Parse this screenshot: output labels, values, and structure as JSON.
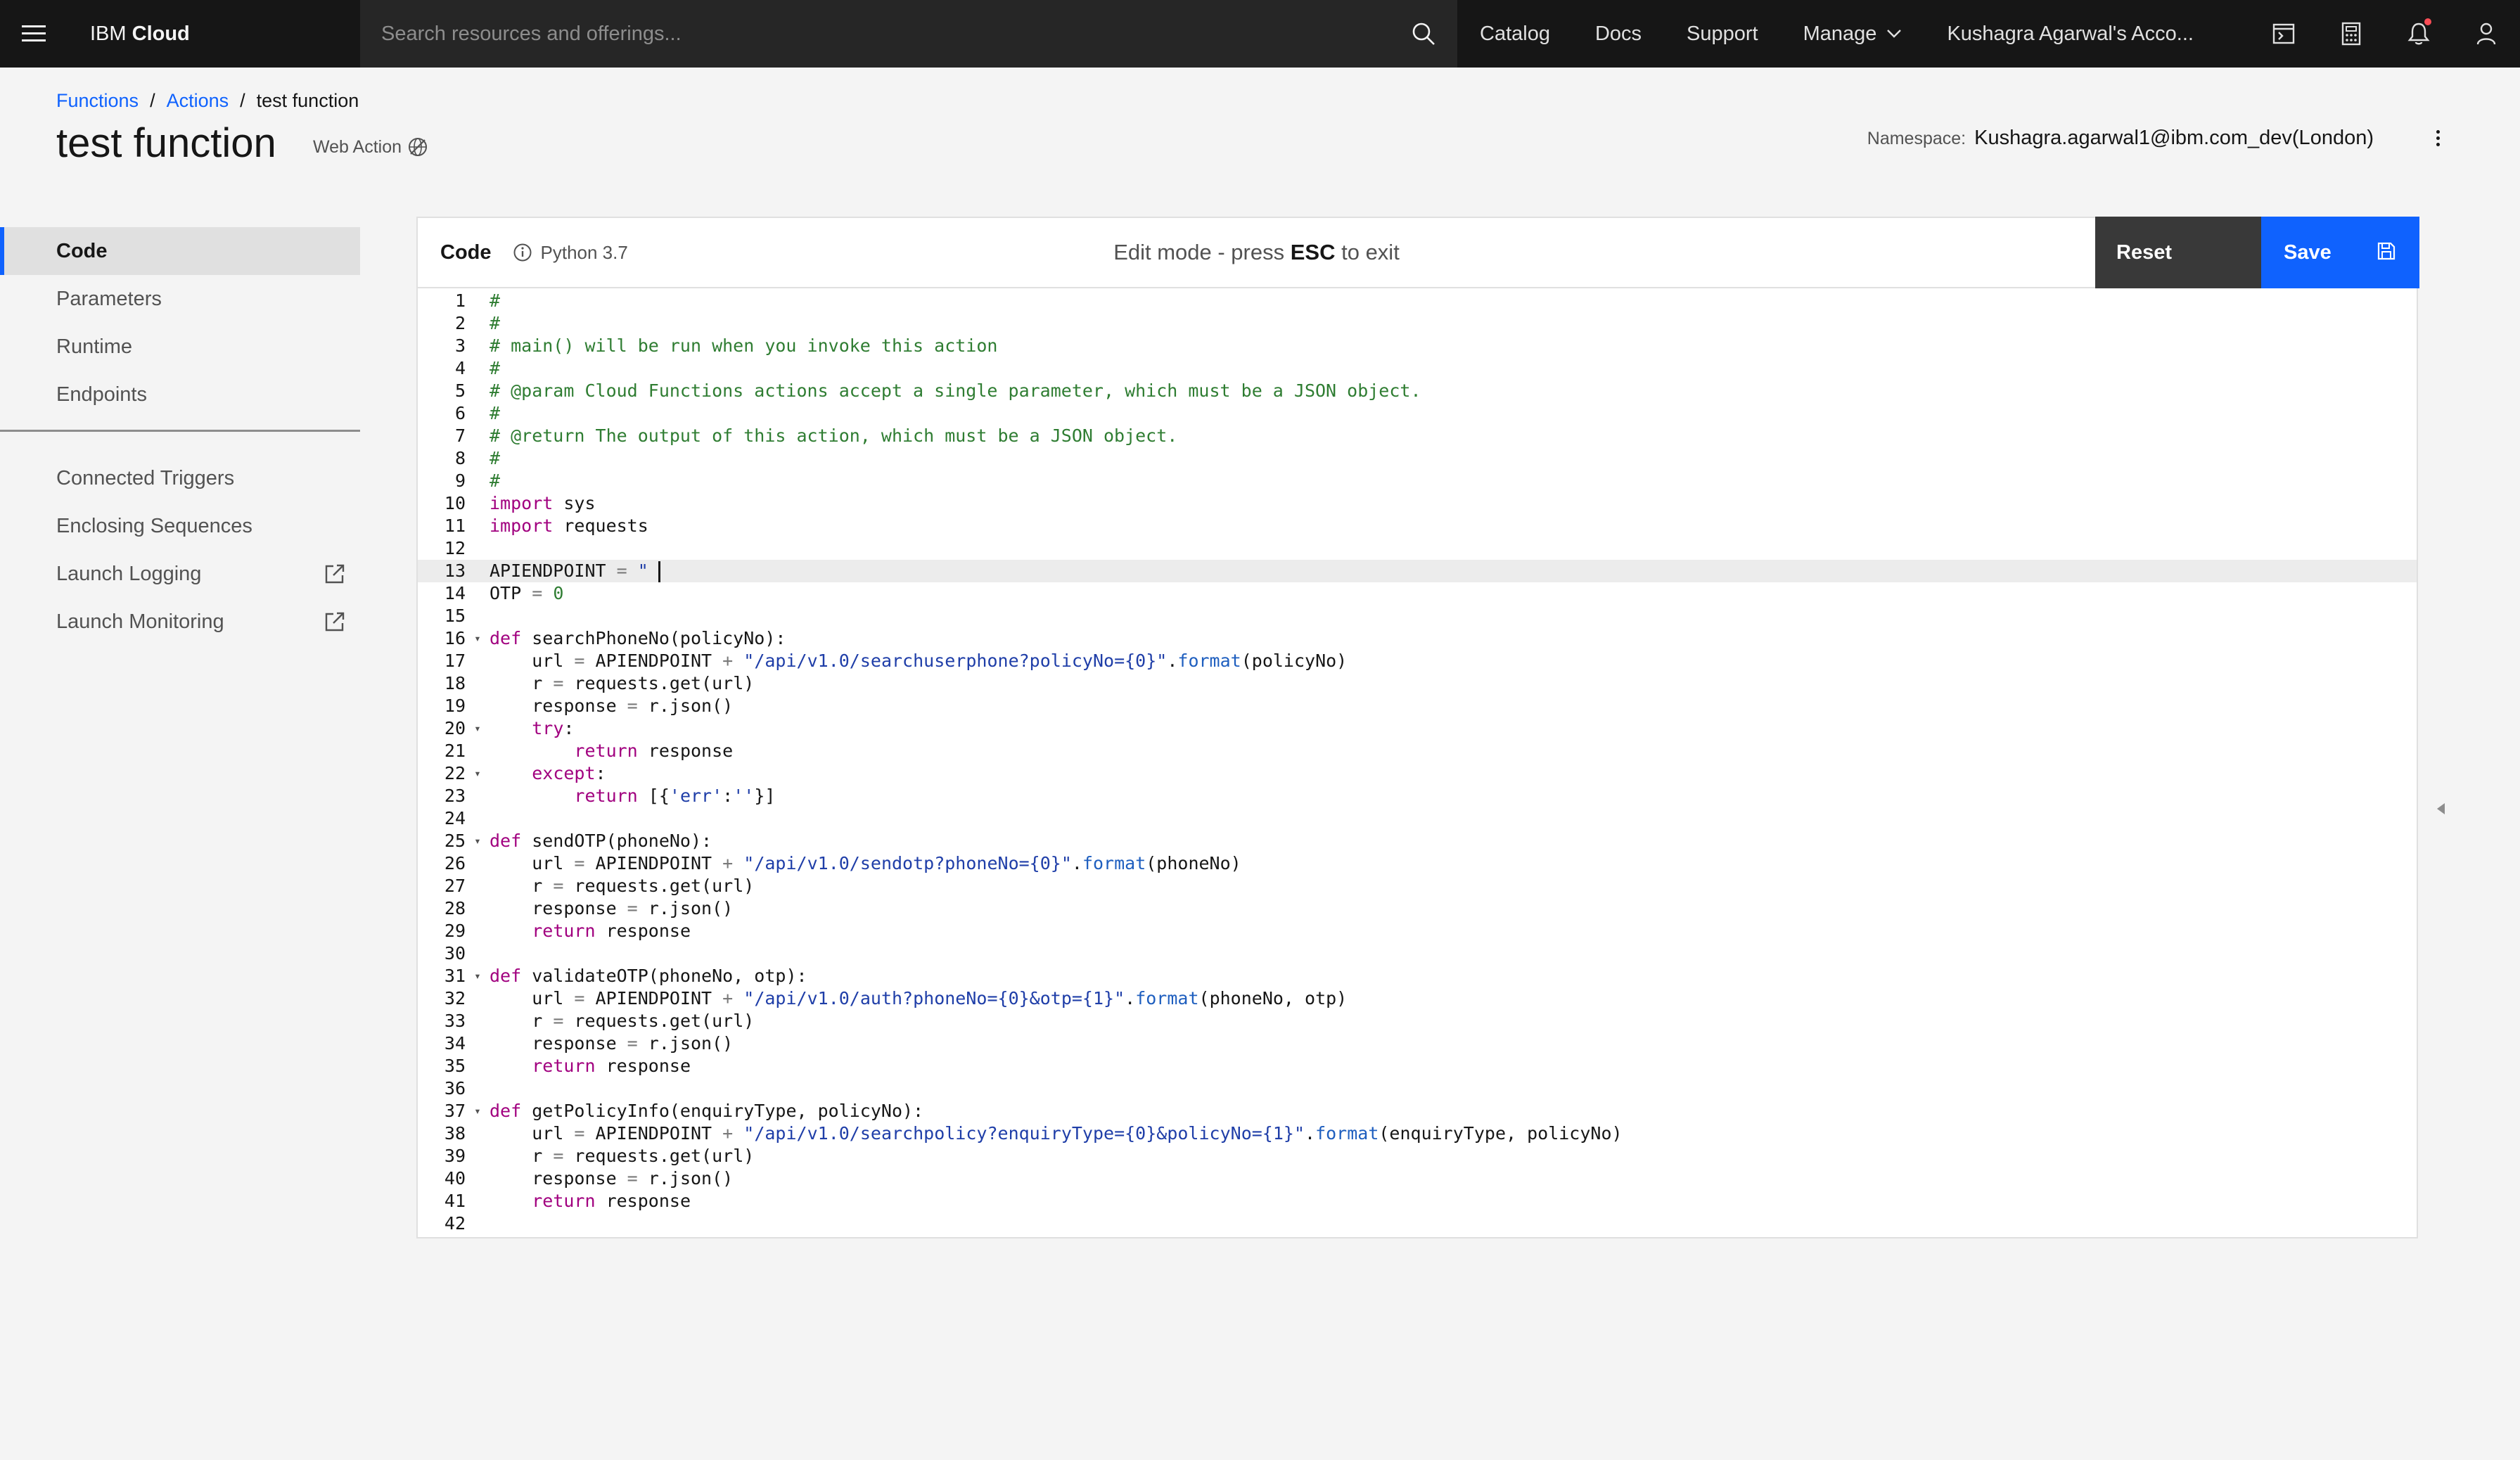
{
  "topbar": {
    "brand_prefix": "IBM",
    "brand_name": "Cloud",
    "search_placeholder": "Search resources and offerings...",
    "links": [
      "Catalog",
      "Docs",
      "Support",
      "Manage",
      "Kushagra Agarwal's Acco..."
    ],
    "icons": [
      "cloud-shell-icon",
      "cost-estimator-icon",
      "notification-icon",
      "user-icon"
    ]
  },
  "breadcrumb": {
    "items": [
      "Functions",
      "Actions"
    ],
    "current": "test function"
  },
  "page": {
    "title": "test function",
    "web_action": "Web Action",
    "namespace_label": "Namespace:",
    "namespace_value": "Kushagra.agarwal1@ibm.com_dev(London)"
  },
  "leftnav": {
    "primary": [
      "Code",
      "Parameters",
      "Runtime",
      "Endpoints"
    ],
    "secondary": [
      "Connected Triggers",
      "Enclosing Sequences",
      "Launch Logging",
      "Launch Monitoring"
    ],
    "active": "Code"
  },
  "editor": {
    "tab_label": "Code",
    "runtime": "Python 3.7",
    "edit_mode_prefix": "Edit mode - press ",
    "edit_mode_key": "ESC",
    "edit_mode_suffix": " to exit",
    "reset_label": "Reset",
    "save_label": "Save",
    "current_line": 13,
    "lines": [
      "#",
      "#",
      "# main() will be run when you invoke this action",
      "#",
      "# @param Cloud Functions actions accept a single parameter, which must be a JSON object.",
      "#",
      "# @return The output of this action, which must be a JSON object.",
      "#",
      "#",
      "import sys",
      "import requests",
      "",
      "APIENDPOINT = \"",
      "OTP = 0",
      "",
      "def searchPhoneNo(policyNo):",
      "    url = APIENDPOINT + \"/api/v1.0/searchuserphone?policyNo={0}\".format(policyNo)",
      "    r = requests.get(url)",
      "    response = r.json()",
      "    try:",
      "        return response",
      "    except:",
      "        return [{'err':''}]",
      "",
      "def sendOTP(phoneNo):",
      "    url = APIENDPOINT + \"/api/v1.0/sendotp?phoneNo={0}\".format(phoneNo)",
      "    r = requests.get(url)",
      "    response = r.json()",
      "    return response",
      "",
      "def validateOTP(phoneNo, otp):",
      "    url = APIENDPOINT + \"/api/v1.0/auth?phoneNo={0}&otp={1}\".format(phoneNo, otp)",
      "    r = requests.get(url)",
      "    response = r.json()",
      "    return response",
      "",
      "def getPolicyInfo(enquiryType, policyNo):",
      "    url = APIENDPOINT + \"/api/v1.0/searchpolicy?enquiryType={0}&policyNo={1}\".format(enquiryType, policyNo)",
      "    r = requests.get(url)",
      "    response = r.json()",
      "    return response",
      ""
    ],
    "fold_lines": [
      16,
      20,
      22,
      25,
      31,
      37
    ]
  },
  "colors": {
    "topbar_bg": "#161616",
    "accent_blue": "#0f62fe",
    "reset_bg": "#393939",
    "notification_dot": "#fa4d56"
  }
}
